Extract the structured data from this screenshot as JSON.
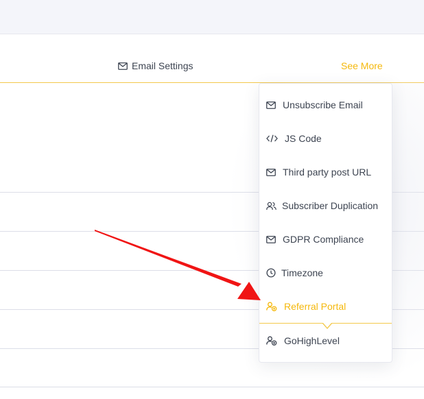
{
  "tabs": {
    "email_settings": "Email Settings",
    "see_more": "See More"
  },
  "dropdown": {
    "items": [
      {
        "label": "Unsubscribe Email",
        "icon": "mail-icon"
      },
      {
        "label": "JS Code",
        "icon": "code-icon"
      },
      {
        "label": "Third party post URL",
        "icon": "mail-icon"
      },
      {
        "label": "Subscriber Duplication",
        "icon": "users-icon"
      },
      {
        "label": "GDPR Compliance",
        "icon": "mail-icon"
      },
      {
        "label": "Timezone",
        "icon": "clock-icon"
      },
      {
        "label": "Referral Portal",
        "icon": "user-plus-icon",
        "active": true
      },
      {
        "label": "GoHighLevel",
        "icon": "user-plus-icon"
      }
    ]
  },
  "colors": {
    "accent": "#f5b80c",
    "text": "#3d4451",
    "annotation_arrow": "#f01414"
  }
}
